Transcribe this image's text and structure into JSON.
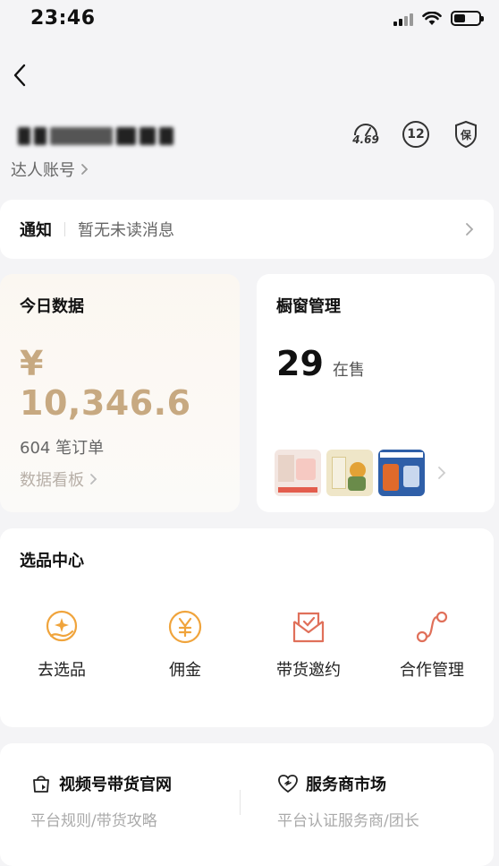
{
  "status_bar": {
    "time": "23:46"
  },
  "account": {
    "type_label": "达人账号",
    "score": "4.69",
    "level": "12",
    "guarantee": "保"
  },
  "notice": {
    "title": "通知",
    "message": "暂无未读消息"
  },
  "today_data": {
    "title": "今日数据",
    "amount": "¥ 10,346.6",
    "orders": "604 笔订单",
    "link": "数据看板"
  },
  "window_mgmt": {
    "title": "橱窗管理",
    "count": "29",
    "unit": "在售"
  },
  "selection_center": {
    "title": "选品中心",
    "items": [
      {
        "label": "去选品",
        "icon": "select-product-icon"
      },
      {
        "label": "佣金",
        "icon": "commission-icon"
      },
      {
        "label": "带货邀约",
        "icon": "invitation-icon"
      },
      {
        "label": "合作管理",
        "icon": "cooperation-icon"
      }
    ]
  },
  "bottom_links": [
    {
      "title": "视频号带货官网",
      "subtitle": "平台规则/带货攻略",
      "icon": "bag-icon"
    },
    {
      "title": "服务商市场",
      "subtitle": "平台认证服务商/团长",
      "icon": "heart-service-icon"
    }
  ],
  "colors": {
    "gold": "#c7a981",
    "orange": "#f0a43c",
    "red": "#e0705a"
  }
}
